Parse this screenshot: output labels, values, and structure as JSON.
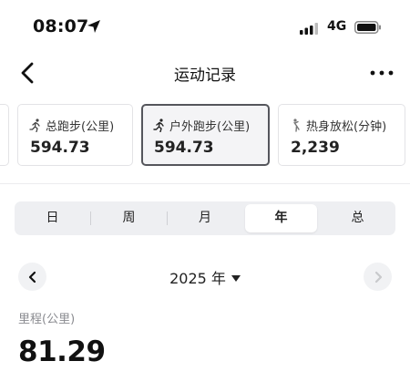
{
  "status_bar": {
    "time": "08:07",
    "network": "4G"
  },
  "nav": {
    "title": "运动记录",
    "more_label": "···"
  },
  "cards": [
    {
      "label": "总跑步(公里)",
      "value": "594.73",
      "icon": "running-icon"
    },
    {
      "label": "户外跑步(公里)",
      "value": "594.73",
      "icon": "outdoor-running-icon",
      "selected": true
    },
    {
      "label": "热身放松(分钟)",
      "value": "2,239",
      "icon": "stretch-icon"
    }
  ],
  "segments": {
    "items": [
      "日",
      "周",
      "月",
      "年",
      "总"
    ],
    "selected": "年"
  },
  "year_nav": {
    "label": "2025 年"
  },
  "metric": {
    "label": "里程(公里)",
    "value": "81.29"
  },
  "colors": {
    "accent_border": "#55565c",
    "muted_text": "#8a8b90",
    "segment_bg": "#eeeff2"
  }
}
